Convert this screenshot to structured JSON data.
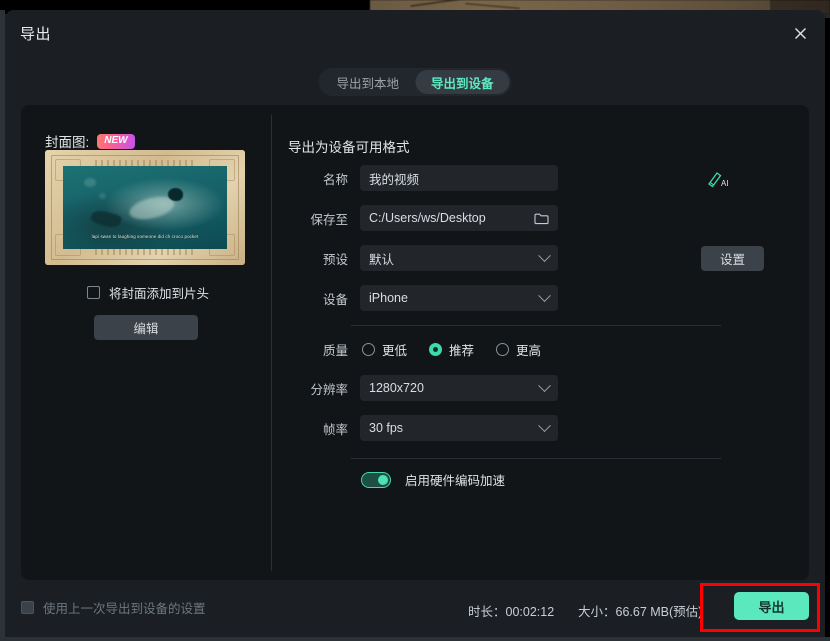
{
  "window": {
    "title": "导出",
    "close_icon": "close-icon"
  },
  "tabs": [
    {
      "label": "导出到本地",
      "active": false
    },
    {
      "label": "导出到设备",
      "active": true
    }
  ],
  "cover": {
    "label": "封面图:",
    "badge": "NEW",
    "thumbnail_subtitle": "lapi swan to laughing someone did ch croco pocket",
    "add_to_intro_checkbox": {
      "label": "将封面添加到片头",
      "checked": false
    },
    "edit_button": "编辑"
  },
  "export_form": {
    "section_title": "导出为设备可用格式",
    "fields": {
      "name": {
        "label": "名称",
        "value": "我的视频",
        "icon": "ai-pen-icon"
      },
      "save_to": {
        "label": "保存至",
        "value": "C:/Users/ws/Desktop",
        "icon": "folder-icon"
      },
      "preset": {
        "label": "预设",
        "value": "默认",
        "button": "设置"
      },
      "device": {
        "label": "设备",
        "value": "iPhone"
      },
      "quality": {
        "label": "质量",
        "options": [
          "更低",
          "推荐",
          "更高"
        ],
        "selected": "推荐"
      },
      "resolution": {
        "label": "分辨率",
        "value": "1280x720"
      },
      "frame_rate": {
        "label": "帧率",
        "value": "30 fps"
      },
      "hardware_accel": {
        "label": "启用硬件编码加速",
        "enabled": true
      }
    }
  },
  "footer": {
    "use_last_settings": {
      "label": "使用上一次导出到设备的设置",
      "checked": false
    },
    "duration": "时长：00:02:12",
    "size": "大小：66.67 MB(预估)",
    "export_button": "导出"
  },
  "colors": {
    "accent": "#5ce8bd",
    "accent_text": "#5ee9c3",
    "highlight": "#ff0000",
    "dialog_bg": "#1b1f24",
    "card_bg": "#121517"
  }
}
